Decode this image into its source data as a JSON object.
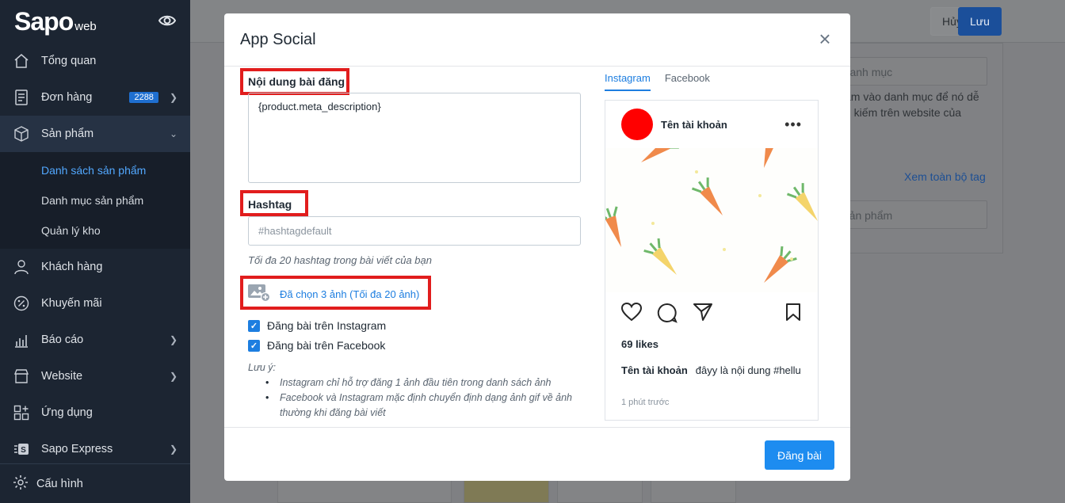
{
  "sidebar": {
    "logo_main": "Sapo",
    "logo_sub": "web",
    "items": [
      {
        "label": "Tổng quan"
      },
      {
        "label": "Đơn hàng",
        "badge": "2288"
      },
      {
        "label": "Sản phẩm"
      },
      {
        "label": "Khách hàng"
      },
      {
        "label": "Khuyến mãi"
      },
      {
        "label": "Báo cáo"
      },
      {
        "label": "Website"
      },
      {
        "label": "Ứng dụng"
      },
      {
        "label": "Sapo Express"
      }
    ],
    "subitems": [
      {
        "label": "Danh sách sản phẩm"
      },
      {
        "label": "Danh mục sản phẩm"
      },
      {
        "label": "Quản lý kho"
      }
    ],
    "footer_label": "Cấu hình"
  },
  "topbar": {
    "cancel_label": "Hủy",
    "save_label": "Lưu"
  },
  "background": {
    "category_placeholder": "n danh mục",
    "category_hint_1": "ẩm vào danh mục để nó dễ",
    "category_hint_2": "n kiếm trên website của",
    "view_all_tags": "Xem toàn bộ tag",
    "tag_placeholder": "o sản phẩm"
  },
  "modal": {
    "title": "App Social",
    "close_symbol": "×",
    "content_label": "Nội dung bài đăng",
    "content_value": "{product.meta_description}",
    "hashtag_label": "Hashtag",
    "hashtag_placeholder": "#hashtagdefault",
    "hashtag_hint": "Tối đa 20 hashtag trong bài viết của bạn",
    "images_selected": "Đã chọn 3 ảnh (Tối đa 20 ảnh)",
    "post_instagram": "Đăng bài trên Instagram",
    "post_facebook": "Đăng bài trên Facebook",
    "note_title": "Lưu ý:",
    "notes": [
      "Instagram chỉ hỗ trợ đăng 1 ảnh đầu tiên trong danh sách ảnh",
      "Facebook và Instagram mặc định chuyển định dạng ảnh gif về ảnh thường khi đăng bài viết"
    ],
    "post_button": "Đăng bài"
  },
  "preview": {
    "tabs": [
      "Instagram",
      "Facebook"
    ],
    "account_name": "Tên tài khoản",
    "more_symbol": "•••",
    "likes": "69 likes",
    "caption_user": "Tên tài khoản",
    "caption_text": "đâyy là nội dung #hellu",
    "time": "1 phút trước"
  },
  "colors": {
    "sidebar_bg": "#1c2532",
    "accent": "#1d8cf0",
    "highlight_box": "#e11d1d",
    "avatar": "#ff0000"
  }
}
